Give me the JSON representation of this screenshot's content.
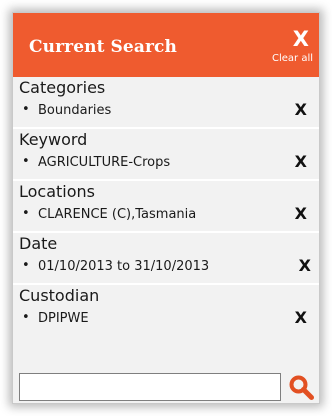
{
  "panel": {
    "title": "Current Search",
    "clear_icon": "X",
    "clear_label": "Clear all"
  },
  "sections": [
    {
      "label": "Categories",
      "value": "Boundaries",
      "remove": "X"
    },
    {
      "label": "Keyword",
      "value": "AGRICULTURE-Crops",
      "remove": "X"
    },
    {
      "label": "Locations",
      "value": "CLARENCE (C),Tasmania",
      "remove": "X"
    },
    {
      "label": "Date",
      "value": "01/10/2013 to 31/10/2013",
      "remove": "X"
    },
    {
      "label": "Custodian",
      "value": "DPIPWE",
      "remove": "X"
    }
  ],
  "search": {
    "value": "",
    "icon": "search-icon"
  },
  "colors": {
    "header_bg": "#ef5b2f",
    "body_bg": "#f2f2f2",
    "search_icon": "#e25022"
  }
}
